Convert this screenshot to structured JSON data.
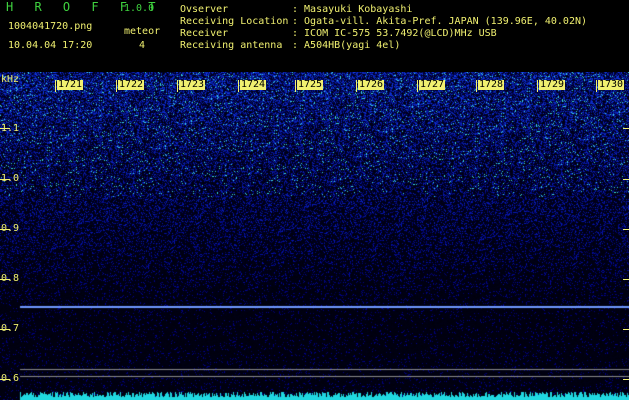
{
  "app": {
    "title": "H R O F F T",
    "version": "1.0.0",
    "filename": "1004041720.png",
    "datetime": "10.04.04 17:20",
    "meteor_label": "meteor",
    "meteor_count": "4"
  },
  "info": {
    "observer_label": "Ovserver",
    "observer_value": ": Masayuki Kobayashi",
    "location_label": "Receiving Location",
    "location_value": ": Ogata-vill. Akita-Pref. JAPAN (139.96E, 40.02N)",
    "receiver_label": "Receiver",
    "receiver_value": ": ICOM IC-575 53.7492(@LCD)MHz USB",
    "antenna_label": "Receiving antenna",
    "antenna_value": ": A504HB(yagi 4el)"
  },
  "spectrogram": {
    "unit_label": "kHz",
    "freq_labels": [
      "1.1",
      "1.0",
      "0.9",
      "0.8",
      "0.7",
      "0.6"
    ],
    "minute_labels": [
      "1721",
      "1722",
      "1723",
      "1724",
      "1725",
      "1726",
      "1727",
      "1728",
      "1729",
      "1730"
    ],
    "colors": {
      "background": "#000000",
      "signal": "#1e3cff",
      "trace": "#7fa7ff",
      "baseline": "#20e0e0",
      "label": "#f0f070"
    }
  }
}
